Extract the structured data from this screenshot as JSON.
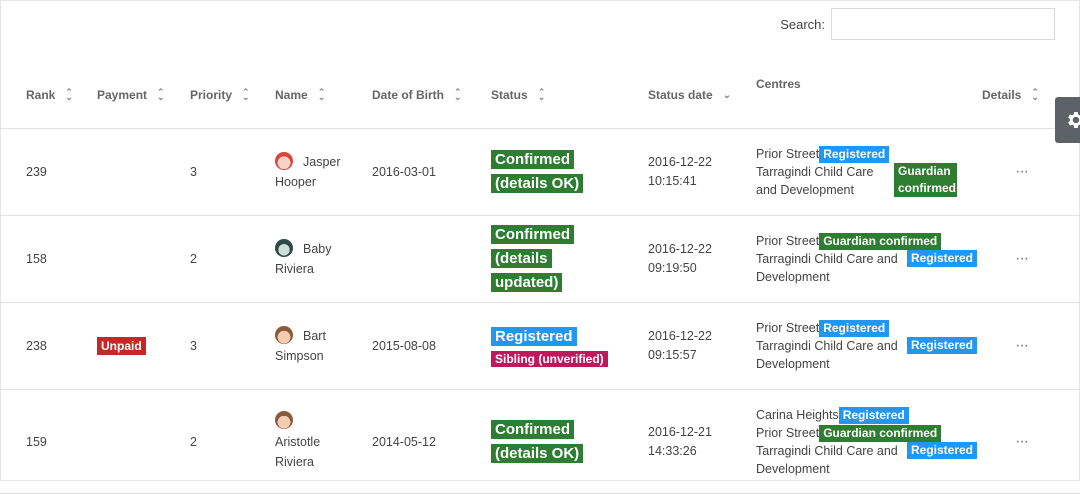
{
  "search": {
    "label": "Search:",
    "value": "",
    "placeholder": ""
  },
  "columns": [
    "Rank",
    "Payment",
    "Priority",
    "Name",
    "Date of Birth",
    "Status",
    "Status date",
    "Centres",
    "Details"
  ],
  "rows": [
    {
      "rank": "239",
      "payment": "",
      "priority": "3",
      "name_first": "Jasper",
      "name_last": "Hooper",
      "avatar": "child-red-hair-icon",
      "dob": "2016-03-01",
      "status": "Confirmed (details OK)",
      "status_color": "#2e7d32",
      "status_extra": "",
      "status_date": "2016-12-22",
      "status_time": "10:15:41",
      "centres": [
        {
          "name": "Prior Street",
          "badge": "Registered",
          "badge_color": "#2196f3"
        },
        {
          "name": "Tarragindi Child Care and Development",
          "badge": "Guardian confirmed",
          "badge_color": "#2e7d32"
        }
      ],
      "details": "···"
    },
    {
      "rank": "158",
      "payment": "",
      "priority": "2",
      "name_first": "Baby",
      "name_last": "Riviera",
      "avatar": "baby-icon",
      "dob": "",
      "status": "Confirmed (details updated)",
      "status_color": "#2e7d32",
      "status_extra": "",
      "status_date": "2016-12-22",
      "status_time": "09:19:50",
      "centres": [
        {
          "name": "Prior Street",
          "badge": "Guardian confirmed",
          "badge_color": "#2e7d32"
        },
        {
          "name": "Tarragindi Child Care and Development",
          "badge": "Registered",
          "badge_color": "#2196f3"
        }
      ],
      "details": "···"
    },
    {
      "rank": "238",
      "payment": "Unpaid",
      "priority": "3",
      "name_first": "Bart",
      "name_last": "Simpson",
      "avatar": "child-boy-icon",
      "dob": "2015-08-08",
      "status": "Registered",
      "status_color": "#2196f3",
      "status_extra": "Sibling (unverified)",
      "status_date": "2016-12-22",
      "status_time": "09:15:57",
      "centres": [
        {
          "name": "Prior Street",
          "badge": "Registered",
          "badge_color": "#2196f3"
        },
        {
          "name": "Tarragindi Child Care and Development",
          "badge": "Registered",
          "badge_color": "#2196f3"
        }
      ],
      "details": "···"
    },
    {
      "rank": "159",
      "payment": "",
      "priority": "2",
      "name_first": "Aristotle",
      "name_last": "Riviera",
      "avatar": "child-boy-icon",
      "dob": "2014-05-12",
      "status": "Confirmed (details OK)",
      "status_color": "#2e7d32",
      "status_extra": "",
      "status_date": "2016-12-21",
      "status_time": "14:33:26",
      "centres": [
        {
          "name": "Carina Heights",
          "badge": "Registered",
          "badge_color": "#2196f3"
        },
        {
          "name": "Prior Street",
          "badge": "Guardian confirmed",
          "badge_color": "#2e7d32"
        },
        {
          "name": "Tarragindi Child Care and Development",
          "badge": "Registered",
          "badge_color": "#2196f3"
        }
      ],
      "details": "···"
    }
  ],
  "settings_tab": {
    "icon": "gear-icon"
  }
}
